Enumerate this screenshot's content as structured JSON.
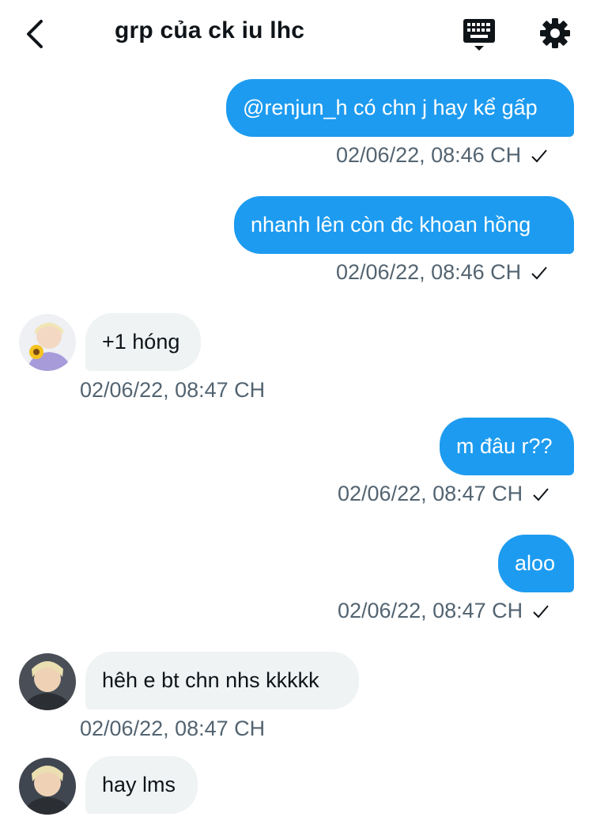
{
  "header": {
    "title": "grp của ck iu lhc"
  },
  "messages": [
    {
      "text": "@renjun_h có chn j hay kể gấp",
      "time": "02/06/22, 08:46 CH"
    },
    {
      "text": "nhanh lên còn đc khoan hồng",
      "time": "02/06/22, 08:46 CH"
    },
    {
      "text": "+1 hóng",
      "time": "02/06/22, 08:47 CH"
    },
    {
      "text": "m đâu r??",
      "time": "02/06/22, 08:47 CH"
    },
    {
      "text": "aloo",
      "time": "02/06/22, 08:47 CH"
    },
    {
      "text": "hêh e bt chn nhs kkkkk",
      "time": "02/06/22, 08:47 CH"
    },
    {
      "text": "hay lms"
    }
  ],
  "colors": {
    "accent": "#1d9bf0",
    "incoming_bubble": "#eff3f4",
    "meta_text": "#536471"
  },
  "icons": [
    "back-arrow-icon",
    "keyboard-icon",
    "gear-icon",
    "sent-check-icon"
  ]
}
